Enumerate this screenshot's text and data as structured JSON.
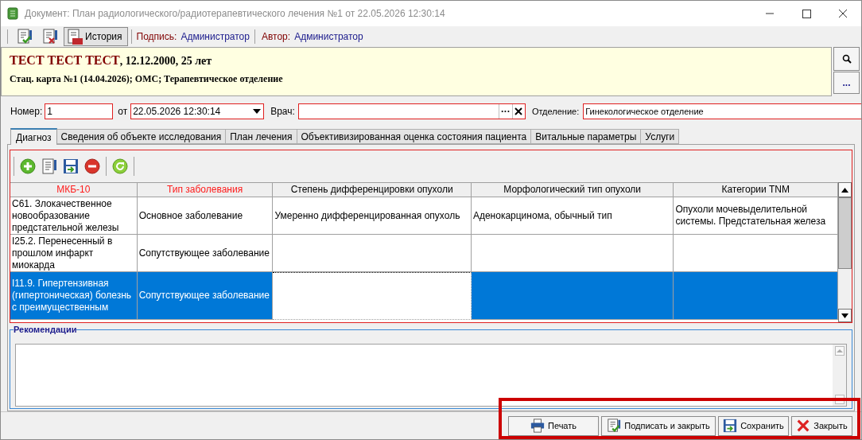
{
  "window": {
    "title": "Документ: План радиологического/радиотерапевтического лечения №1 от 22.05.2026 12:30:14"
  },
  "toolbar": {
    "buttons": [
      {
        "kind": "sign"
      },
      {
        "kind": "unsign"
      },
      {
        "kind": "history",
        "label": "История"
      }
    ],
    "signature": {
      "label": "Подпись:",
      "value": "Администратор"
    },
    "author": {
      "label": "Автор:",
      "value": "Администратор"
    }
  },
  "patient": {
    "name": "ТЕСТ ТЕСТ ТЕСТ",
    "details": ", 12.12.2000, 25 лет",
    "card": "Стац. карта №1 (14.04.2026); ОМС; Терапевтическое отделение",
    "more_button": "..."
  },
  "form": {
    "number": {
      "label": "Номер:",
      "value": "1"
    },
    "date": {
      "label": "от",
      "value": "22.05.2026 12:30:14"
    },
    "doctor": {
      "label": "Врач:",
      "browse": "···"
    },
    "department": {
      "label": "Отделение:",
      "value": "Гинекологическое отделение"
    }
  },
  "tabs": [
    {
      "label": "Диагноз",
      "selected": true
    },
    {
      "label": "Сведения об объекте исследования",
      "selected": false
    },
    {
      "label": "План лечения",
      "selected": false
    },
    {
      "label": "Объективизированная оценка состояния пациента",
      "selected": false
    },
    {
      "label": "Витальные параметры",
      "selected": false
    },
    {
      "label": "Услуги",
      "selected": false
    }
  ],
  "grid_toolbar": [
    {
      "kind": "add"
    },
    {
      "kind": "edit"
    },
    {
      "kind": "save"
    },
    {
      "kind": "delete"
    },
    {
      "kind": "refresh"
    }
  ],
  "table": {
    "columns": [
      {
        "label": "МКБ-10",
        "required": true
      },
      {
        "label": "Тип заболевания",
        "required": true
      },
      {
        "label": "Степень дифференцировки опухоли",
        "required": false
      },
      {
        "label": "Морфологический тип опухоли",
        "required": false
      },
      {
        "label": "Категории TNM",
        "required": false
      }
    ],
    "rows": [
      {
        "selected": false,
        "cells": [
          {
            "text": "C61. Злокачественное новообразование предстательной железы",
            "focused": false
          },
          {
            "text": "Основное заболевание",
            "focused": false
          },
          {
            "text": "Умеренно дифференцированная опухоль",
            "focused": false
          },
          {
            "text": "Аденокарцинома, обычный тип",
            "focused": false
          },
          {
            "text": "Опухоли мочевыделительной системы. Предстательная железа",
            "focused": false
          }
        ]
      },
      {
        "selected": false,
        "cells": [
          {
            "text": "I25.2. Перенесенный в прошлом инфаркт миокарда",
            "focused": false
          },
          {
            "text": "Сопутствующее заболевание",
            "focused": false
          },
          {
            "focused": false
          },
          {
            "focused": false
          },
          {
            "focused": false
          }
        ]
      },
      {
        "selected": true,
        "cells": [
          {
            "text": "I11.9. Гипертензивная (гипертоническая) болезнь с преимущественным",
            "focused": false
          },
          {
            "text": "Сопутствующее заболевание",
            "focused": false
          },
          {
            "focused": true
          },
          {
            "focused": false
          },
          {
            "focused": false
          }
        ]
      }
    ]
  },
  "recommendations": {
    "label": "Рекомендации"
  },
  "buttons": [
    {
      "kind": "print",
      "label": "Печать"
    },
    {
      "kind": "sign",
      "label": "Подписать и закрыть"
    },
    {
      "kind": "save",
      "label": "Сохранить"
    },
    {
      "kind": "close",
      "label": "Закрыть"
    }
  ]
}
